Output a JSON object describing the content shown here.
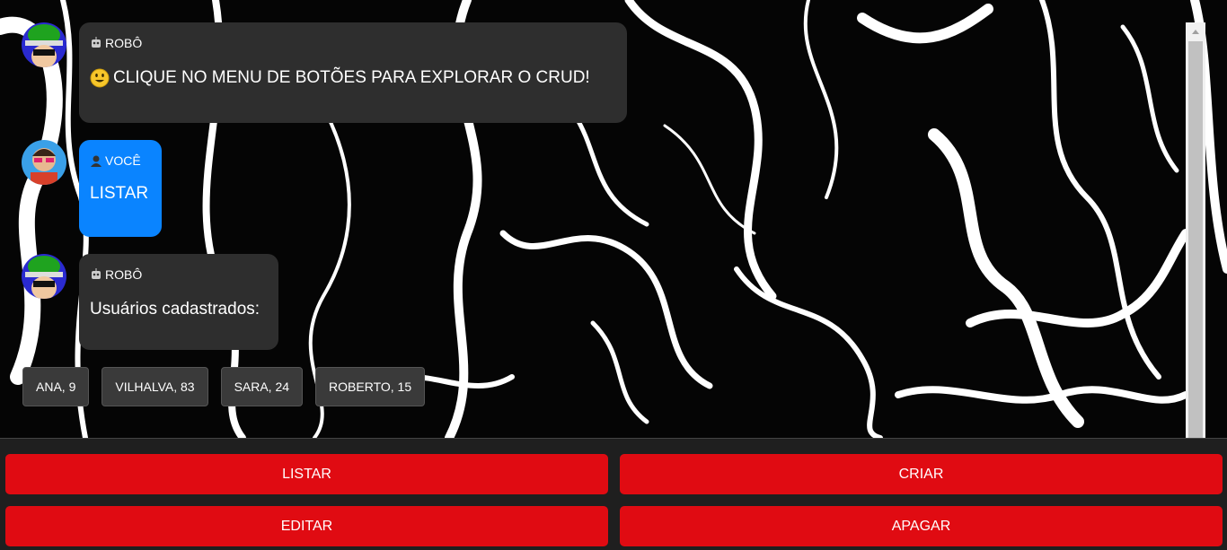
{
  "messages": [
    {
      "sender": "ROBÔ",
      "text": "CLIQUE NO MENU DE BOTÕES PARA EXPLORAR O CRUD!"
    },
    {
      "sender": "VOCÊ",
      "text": "LISTAR"
    },
    {
      "sender": "ROBÔ",
      "text": "Usuários cadastrados:"
    }
  ],
  "users": [
    "ANA, 9",
    "VILHALVA, 83",
    "SARA, 24",
    "ROBERTO, 15"
  ],
  "menu": {
    "listar": "LISTAR",
    "criar": "CRIAR",
    "editar": "EDITAR",
    "apagar": "APAGAR"
  },
  "colors": {
    "bot_bubble": "#2e2e2e",
    "user_bubble": "#0a84ff",
    "button": "#e00b12",
    "menu_bg": "#1f1f1f"
  }
}
